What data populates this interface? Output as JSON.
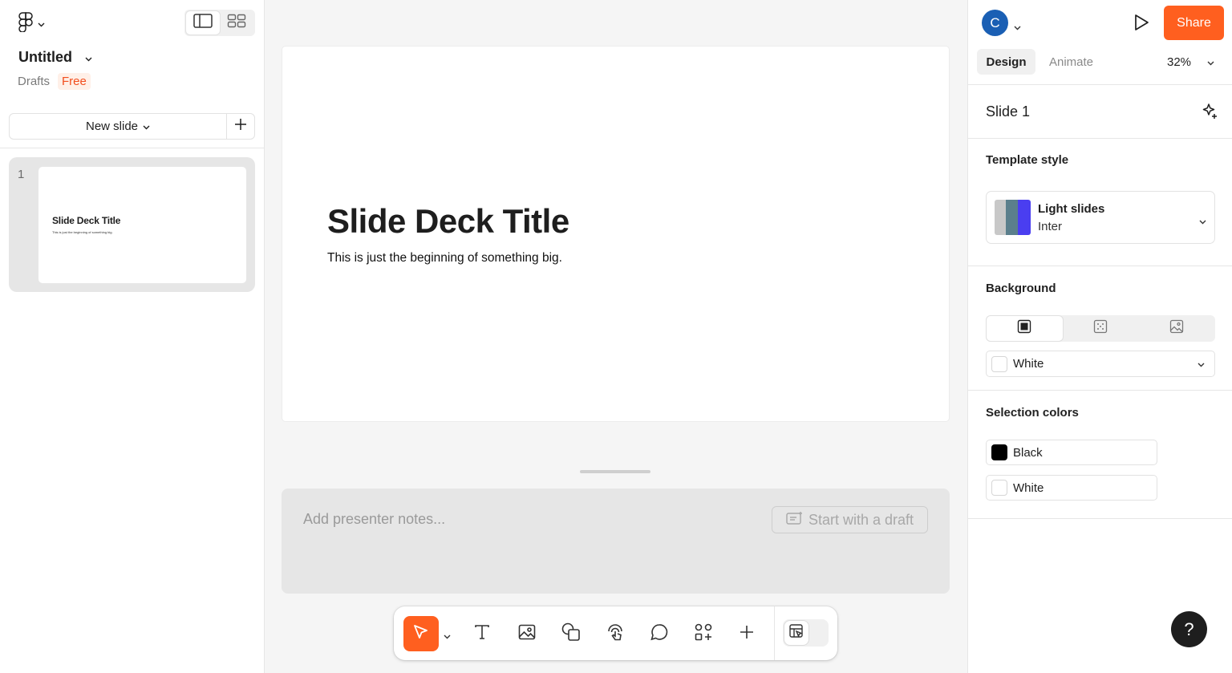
{
  "left_panel": {
    "file_title": "Untitled",
    "location": "Drafts",
    "plan_badge": "Free",
    "new_slide_label": "New slide",
    "slides": [
      {
        "number": "1",
        "title": "Slide Deck Title",
        "subtitle": "This is just the beginning of something big."
      }
    ]
  },
  "canvas": {
    "slide_title": "Slide Deck Title",
    "slide_subtitle": "This is just the beginning of something big.",
    "notes_placeholder": "Add presenter notes...",
    "draft_button_label": "Start with a draft"
  },
  "toolbar": {
    "tools": [
      "move-tool",
      "text-tool",
      "image-tool",
      "shape-tool",
      "interaction-tool",
      "comment-tool",
      "components-tool",
      "add-tool"
    ],
    "active_tool": "move-tool",
    "accent_color": "#ff5f1f"
  },
  "right_panel": {
    "user_initial": "C",
    "share_label": "Share",
    "tabs": {
      "design": "Design",
      "animate": "Animate"
    },
    "zoom": "32%",
    "selected_slide": "Slide 1",
    "template_style": {
      "section_label": "Template style",
      "name": "Light slides",
      "font": "Inter"
    },
    "background": {
      "section_label": "Background",
      "color_name": "White"
    },
    "selection_colors": {
      "section_label": "Selection colors",
      "colors": [
        {
          "name": "Black",
          "hex": "#000000"
        },
        {
          "name": "White",
          "hex": "#ffffff"
        }
      ]
    },
    "help_label": "?"
  }
}
